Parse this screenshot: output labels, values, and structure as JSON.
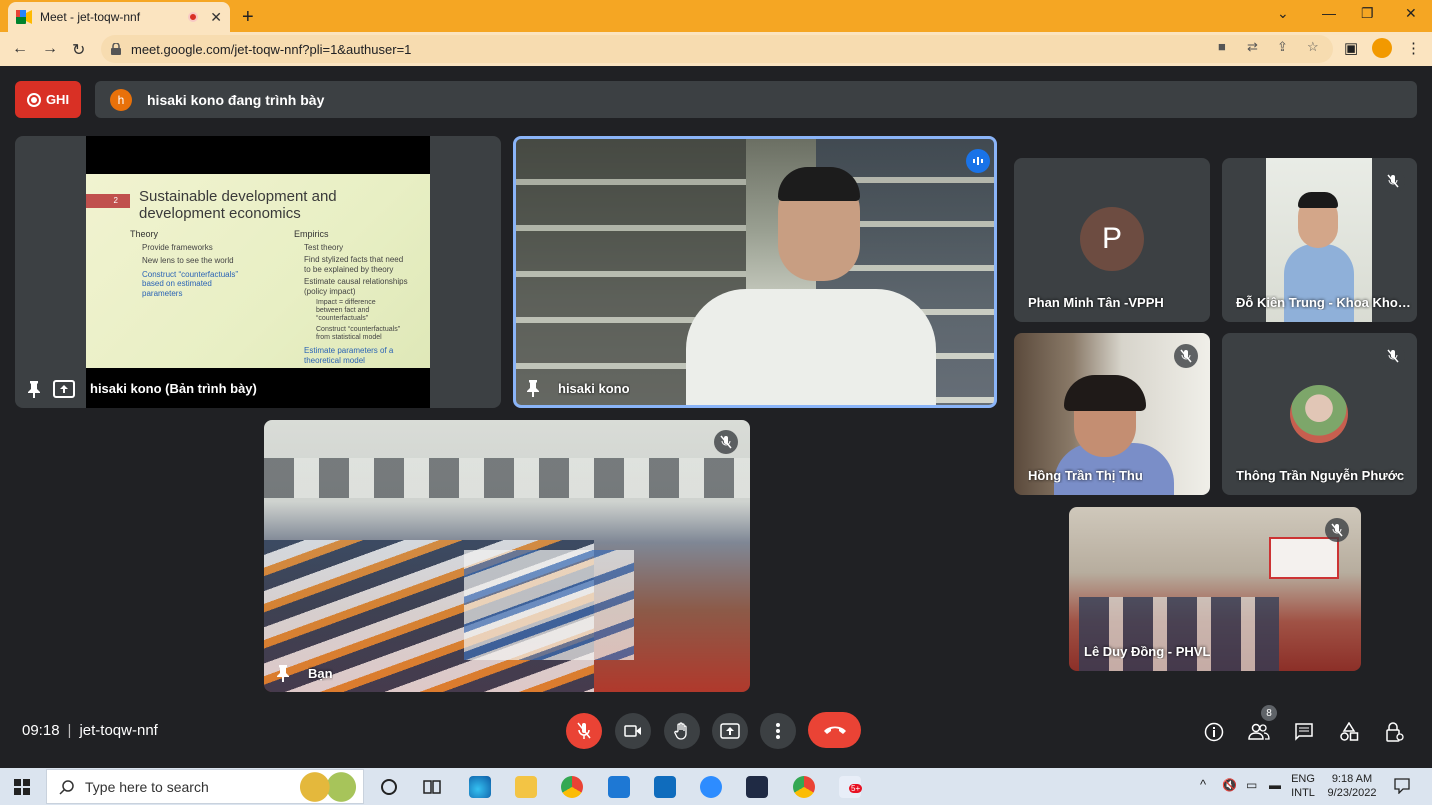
{
  "browser": {
    "tab_title": "Meet - jet-toqw-nnf",
    "tab_close": "✕",
    "new_tab": "+",
    "url": "meet.google.com/jet-toqw-nnf?pli=1&authuser=1"
  },
  "meet": {
    "record_label": "GHI",
    "presenter_initial": "h",
    "presenting_text": "hisaki kono đang trình bày",
    "presentation_tile_name": "hisaki kono (Bản trình bày)",
    "slide": {
      "number": "2",
      "title_line1": "Sustainable development and",
      "title_line2": "development economics",
      "left_heading": "Theory",
      "left_items": [
        "Provide frameworks",
        "New lens to see the world"
      ],
      "left_blue_1": "Construct “counterfactuals”",
      "left_blue_2": "based on estimated",
      "left_blue_3": "parameters",
      "right_heading": "Empirics",
      "right_items": [
        "Test theory",
        "Find stylized facts that need",
        "to be explained by theory",
        "Estimate causal relationships",
        "(policy impact)"
      ],
      "right_sub1a": "Impact = difference",
      "right_sub1b": "between fact and",
      "right_sub1c": "“counterfactuals”",
      "right_sub2a": "Construct “counterfactuals”",
      "right_sub2b": "from statistical model",
      "right_blue_1": "Estimate parameters of a",
      "right_blue_2": "theoretical model"
    },
    "speaker_tile_name": "hisaki kono",
    "self_tile_name": "Bạn",
    "participants": [
      {
        "name": "Phan Minh Tân -VPPH",
        "initial": "P"
      },
      {
        "name": "Đỗ Kiên Trung - Khoa Khoa học..."
      },
      {
        "name": "Hồng Trần Thị Thu"
      },
      {
        "name": "Thông Trần Nguyễn Phước"
      },
      {
        "name": "Lê Duy Đồng - PHVL"
      }
    ],
    "time": "09:18",
    "separator": "|",
    "meeting_code": "jet-toqw-nnf",
    "people_count": "8"
  },
  "taskbar": {
    "search_placeholder": "Type here to search",
    "lang_1": "ENG",
    "lang_2": "INTL",
    "clock_time": "9:18 AM",
    "clock_date": "9/23/2022",
    "notif_badge": "5+"
  }
}
